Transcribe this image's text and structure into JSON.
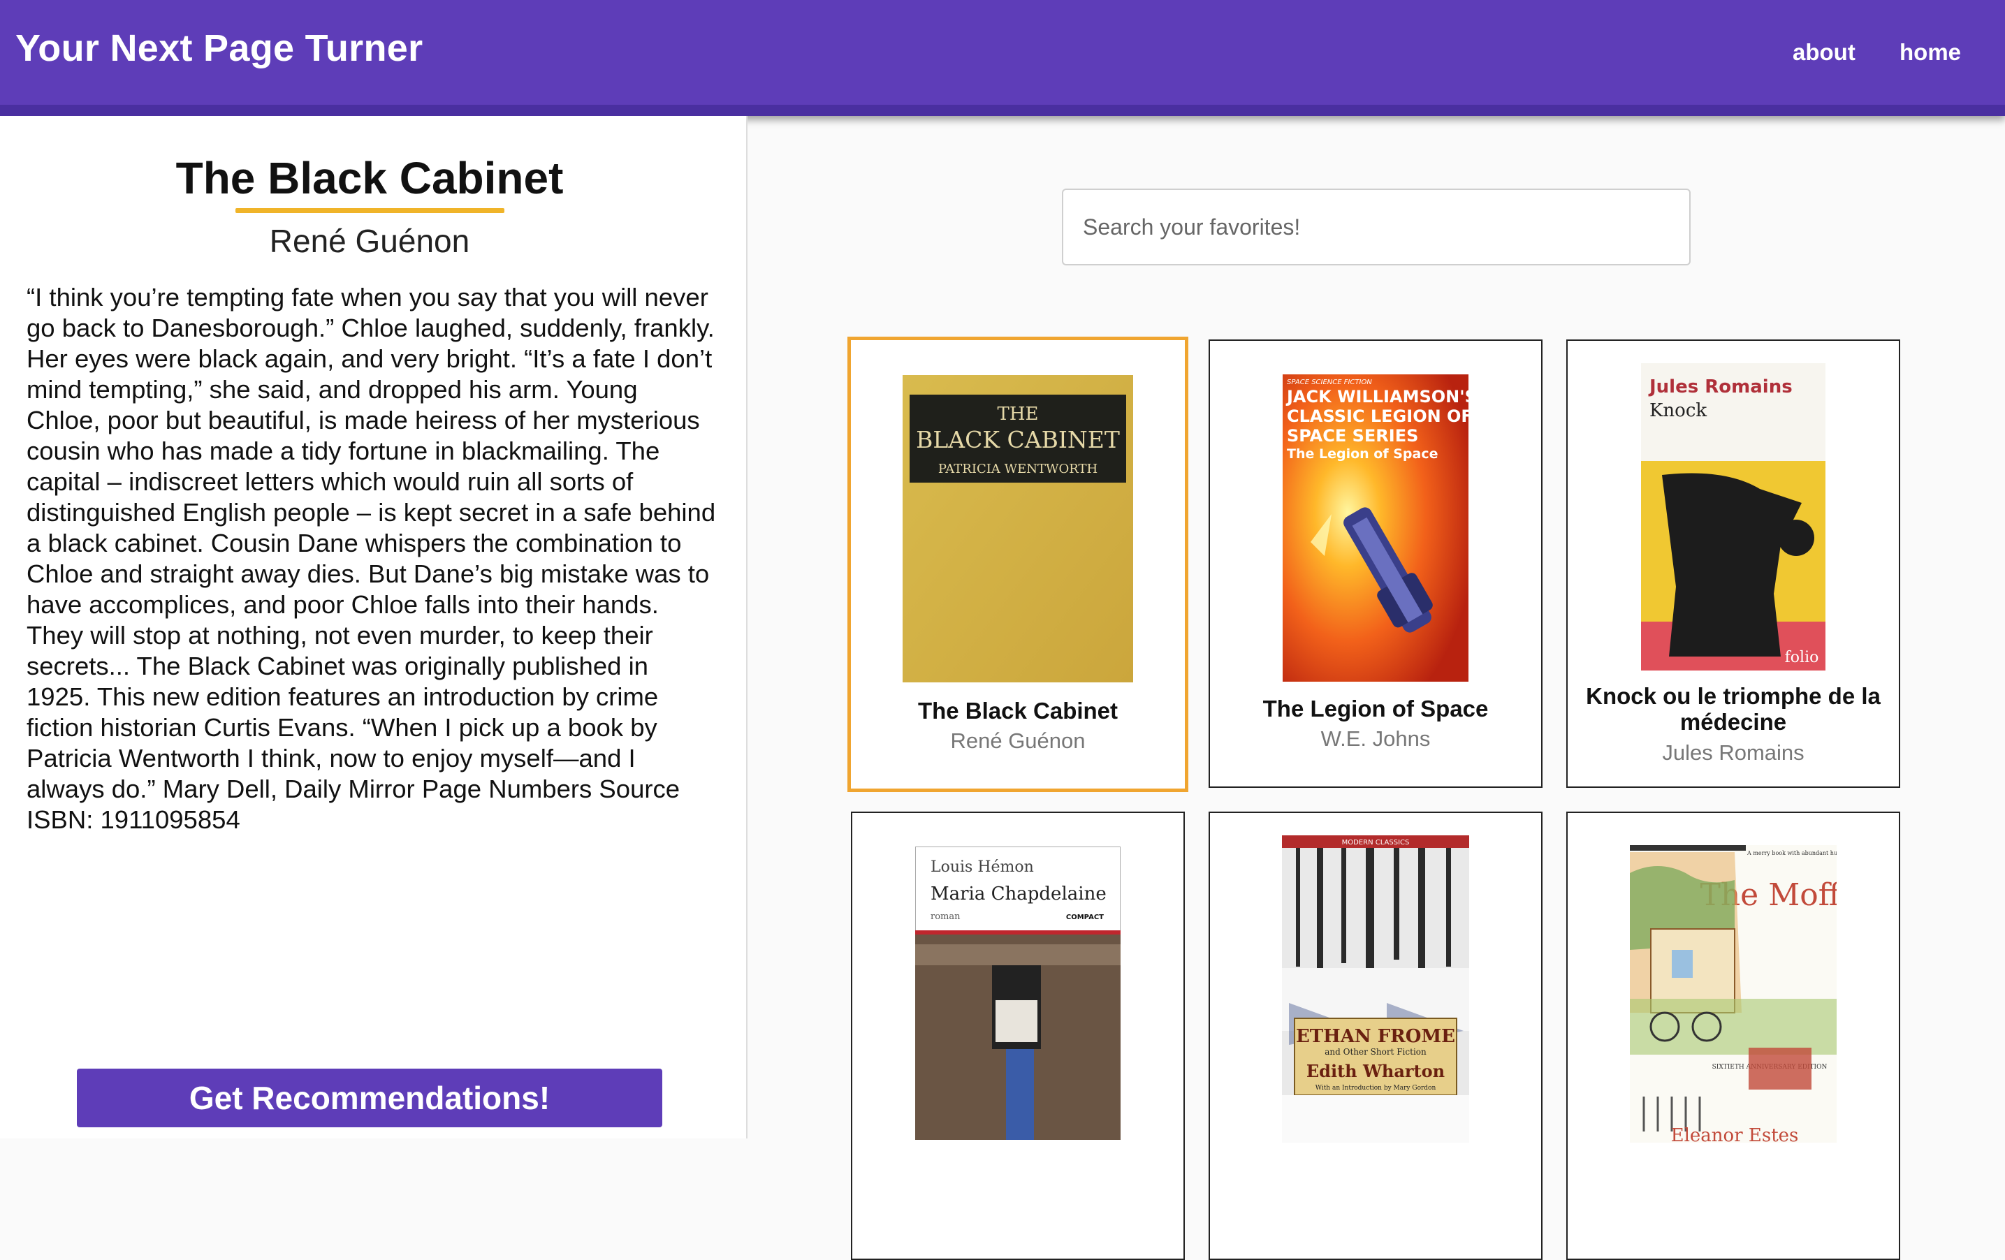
{
  "header": {
    "brand": "Your Next Page Turner",
    "nav": {
      "about": "about",
      "home": "home"
    }
  },
  "detail": {
    "title": "The Black Cabinet",
    "author": "René Guénon",
    "description": "“I think you’re tempting fate when you say that you will never go back to Danesborough.” Chloe laughed, suddenly, frankly. Her eyes were black again, and very bright. “It’s a fate I don’t mind tempting,” she said, and dropped his arm. Young Chloe, poor but beautiful, is made heiress of her mysterious cousin who has made a tidy fortune in blackmailing. The capital – indiscreet letters which would ruin all sorts of distinguished English people – is kept secret in a safe behind a black cabinet. Cousin Dane whispers the combination to Chloe and straight away dies. But Dane’s big mistake was to have accomplices, and poor Chloe falls into their hands. They will stop at nothing, not even murder, to keep their secrets... The Black Cabinet was originally published in 1925. This new edition features an introduction by crime fiction historian Curtis Evans. “When I pick up a book by Patricia Wentworth I think, now to enjoy myself—and I always do.” Mary Dell, Daily Mirror Page Numbers Source ISBN: 1911095854",
    "button_label": "Get Recommendations!"
  },
  "search": {
    "placeholder": "Search your favorites!"
  },
  "books": [
    {
      "title": "The Black Cabinet",
      "author": "René Guénon",
      "selected": true,
      "cover": {
        "line1": "THE",
        "line2": "BLACK CABINET",
        "line3": "PATRICIA WENTWORTH"
      }
    },
    {
      "title": "The Legion of Space",
      "author": "W.E. Johns",
      "cover": {
        "tag": "SPACE SCIENCE FICTION",
        "line1": "JACK WILLIAMSON'S",
        "line2": "CLASSIC LEGION OF",
        "line3": "SPACE SERIES",
        "line4": "The Legion of Space"
      }
    },
    {
      "title": "Knock ou le triomphe de la médecine",
      "author": "Jules Romains",
      "cover": {
        "author": "Jules Romains",
        "title": "Knock",
        "imprint": "folio"
      }
    },
    {
      "cover": {
        "author": "Louis Hémon",
        "title": "Maria Chapdelaine",
        "sub": "roman",
        "imprint": "COMPACT"
      }
    },
    {
      "cover": {
        "series": "MODERN CLASSICS",
        "title": "ETHAN FROME",
        "sub": "and Other Short Fiction",
        "author": "Edith Wharton",
        "intro": "With an Introduction by Mary Gordon"
      }
    },
    {
      "cover": {
        "title": "The Moffats",
        "author": "Eleanor Estes",
        "edition": "SIXTIETH ANNIVERSARY EDITION",
        "quote": "A merry book with abundant humor. — The Horn Book"
      }
    }
  ]
}
